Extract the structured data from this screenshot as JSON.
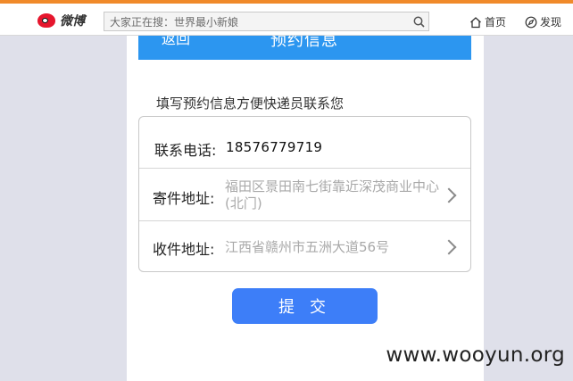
{
  "weibo_bar": {
    "logo_text": "微博",
    "search_placeholder": "大家正在搜：世界最小新娘",
    "nav_home": "首页",
    "nav_discover": "发现",
    "accent": "#f08a2a"
  },
  "header": {
    "back_label": "返回",
    "title": "预约信息",
    "color": "#2c96f0"
  },
  "form": {
    "instruction": "填写预约信息方便快递员联系您",
    "phone_label": "联系电话:",
    "phone_value": "18576779719",
    "sender_label": "寄件地址:",
    "sender_value": "福田区景田南七街靠近深茂商业中心(北门)",
    "receiver_label": "收件地址:",
    "receiver_value": "江西省赣州市五洲大道56号"
  },
  "submit_label": "提 交",
  "submit_color": "#3d7ef8",
  "watermark": "www.wooyun.org",
  "icons": [
    "weibo-logo-icon",
    "search-icon",
    "home-icon",
    "compass-icon",
    "chevron-right-icon"
  ]
}
